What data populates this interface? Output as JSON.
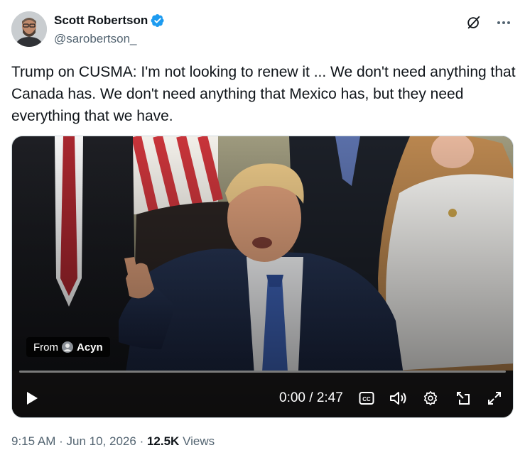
{
  "author": {
    "display_name": "Scott Robertson",
    "handle": "@sarobertson_",
    "verified_icon": "verified-badge-icon",
    "verified_color": "#1d9bf0"
  },
  "header_actions": {
    "grok_icon": "grok-icon",
    "more_icon": "more-icon",
    "more_label": "···"
  },
  "tweet": {
    "text": "Trump on CUSMA: I'm not looking to renew it ... We don't need anything that Canada has. We don't need anything that Mexico has, but they need everything that we have."
  },
  "video": {
    "from_label": "From",
    "source_name": "Acyn",
    "time_display": "0:00 / 2:47",
    "progress": 0,
    "controls": [
      "play-icon",
      "captions-icon",
      "volume-icon",
      "settings-icon",
      "picture-in-picture-icon",
      "fullscreen-icon"
    ]
  },
  "meta": {
    "time": "9:15 AM",
    "separator1": "·",
    "date": "Jun 10, 2026",
    "separator2": "·",
    "views_count": "12.5K",
    "views_label": "Views"
  },
  "colors": {
    "text_primary": "#0f1419",
    "text_secondary": "#536471",
    "accent": "#1d9bf0"
  }
}
